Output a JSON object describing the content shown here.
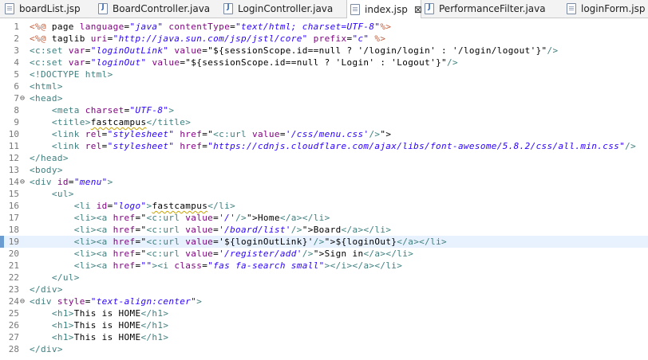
{
  "tabs": [
    {
      "label": "boardList.jsp",
      "icon": "jsp-file-icon",
      "active": false
    },
    {
      "label": "BoardController.java",
      "icon": "java-file-icon",
      "active": false
    },
    {
      "label": "LoginController.java",
      "icon": "java-file-icon",
      "active": false
    },
    {
      "label": "index.jsp",
      "icon": "jsp-file-icon",
      "active": true,
      "close": "⊠"
    },
    {
      "label": "PerformanceFilter.java",
      "icon": "java-file-icon",
      "active": false
    },
    {
      "label": "loginForm.jsp",
      "icon": "jsp-file-icon",
      "active": false
    }
  ],
  "editor": {
    "current_line": 19,
    "lines": [
      {
        "n": "1",
        "t": [
          [
            "tk-jsp",
            "<%@"
          ],
          [
            "tk-text",
            " page "
          ],
          [
            "tk-attr",
            "language"
          ],
          [
            "tk-text",
            "="
          ],
          [
            "tk-val",
            "\"java\""
          ],
          [
            "tk-text",
            " "
          ],
          [
            "tk-attr",
            "contentType"
          ],
          [
            "tk-text",
            "="
          ],
          [
            "tk-val",
            "\"text/html; charset=UTF-8\""
          ],
          [
            "tk-jsp",
            "%>"
          ]
        ]
      },
      {
        "n": "2",
        "t": [
          [
            "tk-jsp",
            "<%@"
          ],
          [
            "tk-text",
            " taglib "
          ],
          [
            "tk-attr",
            "uri"
          ],
          [
            "tk-text",
            "="
          ],
          [
            "tk-val",
            "\"http://java.sun.com/jsp/jstl/core\""
          ],
          [
            "tk-text",
            " "
          ],
          [
            "tk-attr",
            "prefix"
          ],
          [
            "tk-text",
            "="
          ],
          [
            "tk-val",
            "\"c\""
          ],
          [
            "tk-text",
            " "
          ],
          [
            "tk-jsp",
            "%>"
          ]
        ]
      },
      {
        "n": "3",
        "t": [
          [
            "tk-tag",
            "<c:set"
          ],
          [
            "tk-text",
            " "
          ],
          [
            "tk-attr",
            "var"
          ],
          [
            "tk-text",
            "="
          ],
          [
            "tk-val",
            "\"loginOutLink\""
          ],
          [
            "tk-text",
            " "
          ],
          [
            "tk-attr",
            "value"
          ],
          [
            "tk-text",
            "=\"${sessionScope.id==null ? '/login/login' : '/login/logout'}\""
          ],
          [
            "tk-tag",
            "/>"
          ]
        ]
      },
      {
        "n": "4",
        "t": [
          [
            "tk-tag",
            "<c:set"
          ],
          [
            "tk-text",
            " "
          ],
          [
            "tk-attr",
            "var"
          ],
          [
            "tk-text",
            "="
          ],
          [
            "tk-val",
            "\"loginOut\""
          ],
          [
            "tk-text",
            " "
          ],
          [
            "tk-attr",
            "value"
          ],
          [
            "tk-text",
            "=\"${sessionScope.id==null ? 'Login' : 'Logout'}\""
          ],
          [
            "tk-tag",
            "/>"
          ]
        ]
      },
      {
        "n": "5",
        "t": [
          [
            "tk-doctype",
            "<!DOCTYPE html>"
          ]
        ]
      },
      {
        "n": "6",
        "t": [
          [
            "tk-tag",
            "<html>"
          ]
        ]
      },
      {
        "n": "7",
        "fold": "⊖",
        "t": [
          [
            "tk-tag",
            "<head>"
          ]
        ]
      },
      {
        "n": "8",
        "t": [
          [
            "tk-text",
            "    "
          ],
          [
            "tk-tag",
            "<meta"
          ],
          [
            "tk-text",
            " "
          ],
          [
            "tk-attr",
            "charset"
          ],
          [
            "tk-text",
            "="
          ],
          [
            "tk-val",
            "\"UTF-8\""
          ],
          [
            "tk-tag",
            ">"
          ]
        ]
      },
      {
        "n": "9",
        "t": [
          [
            "tk-text",
            "    "
          ],
          [
            "tk-tag",
            "<title>"
          ],
          [
            "tk-el squiggle",
            "fastcampus"
          ],
          [
            "tk-tag",
            "</title>"
          ]
        ]
      },
      {
        "n": "10",
        "t": [
          [
            "tk-text",
            "    "
          ],
          [
            "tk-tag",
            "<link"
          ],
          [
            "tk-text",
            " "
          ],
          [
            "tk-attr",
            "rel"
          ],
          [
            "tk-text",
            "="
          ],
          [
            "tk-val",
            "\"stylesheet\""
          ],
          [
            "tk-text",
            " "
          ],
          [
            "tk-attr",
            "href"
          ],
          [
            "tk-text",
            "=\""
          ],
          [
            "tk-tag",
            "<c:url"
          ],
          [
            "tk-text",
            " "
          ],
          [
            "tk-attr",
            "value"
          ],
          [
            "tk-text",
            "="
          ],
          [
            "tk-val",
            "'/css/menu.css'"
          ],
          [
            "tk-tag",
            "/>"
          ],
          [
            "tk-text",
            "\">"
          ]
        ]
      },
      {
        "n": "11",
        "t": [
          [
            "tk-text",
            "    "
          ],
          [
            "tk-tag",
            "<link"
          ],
          [
            "tk-text",
            " "
          ],
          [
            "tk-attr",
            "rel"
          ],
          [
            "tk-text",
            "="
          ],
          [
            "tk-val",
            "\"stylesheet\""
          ],
          [
            "tk-text",
            " "
          ],
          [
            "tk-attr",
            "href"
          ],
          [
            "tk-text",
            "="
          ],
          [
            "tk-val",
            "\"https://cdnjs.cloudflare.com/ajax/libs/font-awesome/5.8.2/css/all.min.css\""
          ],
          [
            "tk-tag",
            "/>"
          ]
        ]
      },
      {
        "n": "12",
        "t": [
          [
            "tk-tag",
            "</head>"
          ]
        ]
      },
      {
        "n": "13",
        "t": [
          [
            "tk-tag",
            "<body>"
          ]
        ]
      },
      {
        "n": "14",
        "fold": "⊖",
        "t": [
          [
            "tk-tag",
            "<div"
          ],
          [
            "tk-text",
            " "
          ],
          [
            "tk-attr",
            "id"
          ],
          [
            "tk-text",
            "="
          ],
          [
            "tk-val",
            "\"menu\""
          ],
          [
            "tk-tag",
            ">"
          ]
        ]
      },
      {
        "n": "15",
        "t": [
          [
            "tk-text",
            "    "
          ],
          [
            "tk-tag",
            "<ul>"
          ]
        ]
      },
      {
        "n": "16",
        "t": [
          [
            "tk-text",
            "        "
          ],
          [
            "tk-tag",
            "<li"
          ],
          [
            "tk-text",
            " "
          ],
          [
            "tk-attr",
            "id"
          ],
          [
            "tk-text",
            "="
          ],
          [
            "tk-val",
            "\"logo\""
          ],
          [
            "tk-tag",
            ">"
          ],
          [
            "tk-el squiggle",
            "fastcampus"
          ],
          [
            "tk-tag",
            "</li>"
          ]
        ]
      },
      {
        "n": "17",
        "t": [
          [
            "tk-text",
            "        "
          ],
          [
            "tk-tag",
            "<li><a"
          ],
          [
            "tk-text",
            " "
          ],
          [
            "tk-attr",
            "href"
          ],
          [
            "tk-text",
            "=\""
          ],
          [
            "tk-tag",
            "<c:url"
          ],
          [
            "tk-text",
            " "
          ],
          [
            "tk-attr",
            "value"
          ],
          [
            "tk-text",
            "="
          ],
          [
            "tk-val",
            "'/'"
          ],
          [
            "tk-tag",
            "/>"
          ],
          [
            "tk-text",
            "\">Home"
          ],
          [
            "tk-tag",
            "</a></li>"
          ]
        ]
      },
      {
        "n": "18",
        "t": [
          [
            "tk-text",
            "        "
          ],
          [
            "tk-tag",
            "<li><a"
          ],
          [
            "tk-text",
            " "
          ],
          [
            "tk-attr",
            "href"
          ],
          [
            "tk-text",
            "=\""
          ],
          [
            "tk-tag",
            "<c:url"
          ],
          [
            "tk-text",
            " "
          ],
          [
            "tk-attr",
            "value"
          ],
          [
            "tk-text",
            "="
          ],
          [
            "tk-val",
            "'/board/list'"
          ],
          [
            "tk-tag",
            "/>"
          ],
          [
            "tk-text",
            "\">Board"
          ],
          [
            "tk-tag",
            "</a></li>"
          ]
        ]
      },
      {
        "n": "19",
        "t": [
          [
            "tk-text",
            "        "
          ],
          [
            "tk-tag",
            "<li><a"
          ],
          [
            "tk-text",
            " "
          ],
          [
            "tk-attr",
            "href"
          ],
          [
            "tk-text",
            "=\""
          ],
          [
            "tk-tag",
            "<c:url"
          ],
          [
            "tk-text",
            " "
          ],
          [
            "tk-attr",
            "value"
          ],
          [
            "tk-text",
            "='${loginOutLink}'"
          ],
          [
            "tk-tag",
            "/>"
          ],
          [
            "tk-text",
            "\">${loginOut}"
          ],
          [
            "tk-tag",
            "</a></li>"
          ]
        ]
      },
      {
        "n": "20",
        "t": [
          [
            "tk-text",
            "        "
          ],
          [
            "tk-tag",
            "<li><a"
          ],
          [
            "tk-text",
            " "
          ],
          [
            "tk-attr",
            "href"
          ],
          [
            "tk-text",
            "=\""
          ],
          [
            "tk-tag",
            "<c:url"
          ],
          [
            "tk-text",
            " "
          ],
          [
            "tk-attr",
            "value"
          ],
          [
            "tk-text",
            "="
          ],
          [
            "tk-val",
            "'/register/add'"
          ],
          [
            "tk-tag",
            "/>"
          ],
          [
            "tk-text",
            "\">Sign in"
          ],
          [
            "tk-tag",
            "</a></li>"
          ]
        ]
      },
      {
        "n": "21",
        "t": [
          [
            "tk-text",
            "        "
          ],
          [
            "tk-tag",
            "<li><a"
          ],
          [
            "tk-text",
            " "
          ],
          [
            "tk-attr",
            "href"
          ],
          [
            "tk-text",
            "="
          ],
          [
            "tk-val",
            "\"\""
          ],
          [
            "tk-tag",
            "><i"
          ],
          [
            "tk-text",
            " "
          ],
          [
            "tk-attr",
            "class"
          ],
          [
            "tk-text",
            "="
          ],
          [
            "tk-val",
            "\"fas fa-search small\""
          ],
          [
            "tk-tag",
            "></i></a></li>"
          ]
        ]
      },
      {
        "n": "22",
        "t": [
          [
            "tk-text",
            "    "
          ],
          [
            "tk-tag",
            "</ul>"
          ]
        ]
      },
      {
        "n": "23",
        "t": [
          [
            "tk-tag",
            "</div>"
          ]
        ]
      },
      {
        "n": "24",
        "fold": "⊖",
        "t": [
          [
            "tk-tag",
            "<div"
          ],
          [
            "tk-text",
            " "
          ],
          [
            "tk-attr",
            "style"
          ],
          [
            "tk-text",
            "="
          ],
          [
            "tk-val",
            "\"text-align:center\""
          ],
          [
            "tk-tag",
            ">"
          ]
        ]
      },
      {
        "n": "25",
        "t": [
          [
            "tk-text",
            "    "
          ],
          [
            "tk-tag",
            "<h1>"
          ],
          [
            "tk-text",
            "This is HOME"
          ],
          [
            "tk-tag",
            "</h1>"
          ]
        ]
      },
      {
        "n": "26",
        "t": [
          [
            "tk-text",
            "    "
          ],
          [
            "tk-tag",
            "<h1>"
          ],
          [
            "tk-text",
            "This is HOME"
          ],
          [
            "tk-tag",
            "</h1>"
          ]
        ]
      },
      {
        "n": "27",
        "t": [
          [
            "tk-text",
            "    "
          ],
          [
            "tk-tag",
            "<h1>"
          ],
          [
            "tk-text",
            "This is HOME"
          ],
          [
            "tk-tag",
            "</h1>"
          ]
        ]
      },
      {
        "n": "28",
        "t": [
          [
            "tk-tag",
            "</div>"
          ]
        ]
      }
    ]
  }
}
